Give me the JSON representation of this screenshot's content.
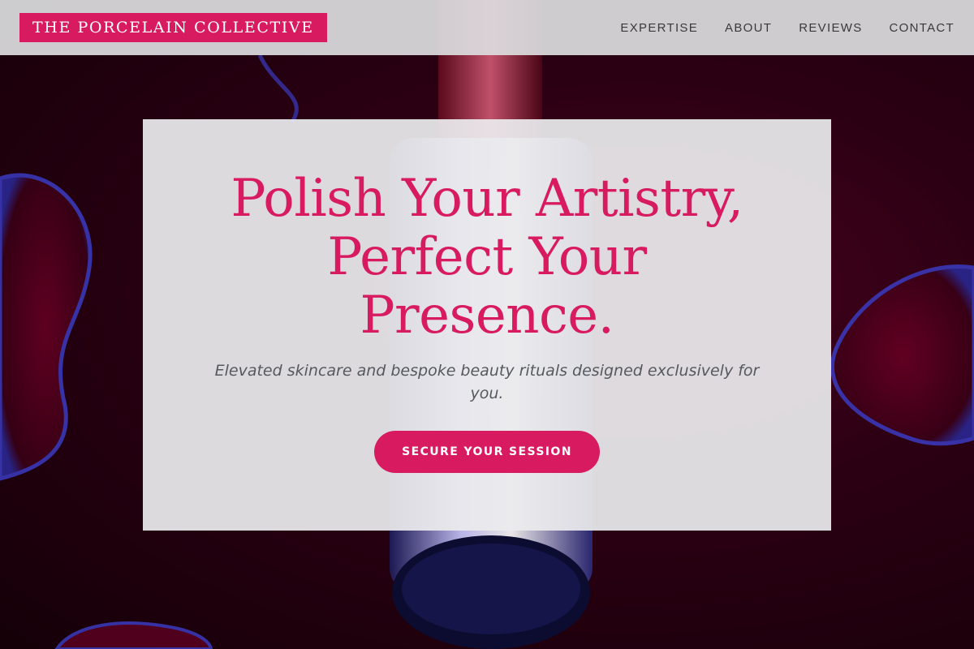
{
  "header": {
    "brand": "THE PORCELAIN COLLECTIVE",
    "nav": [
      "EXPERTISE",
      "ABOUT",
      "REVIEWS",
      "CONTACT"
    ]
  },
  "hero": {
    "title_lines": [
      "Polish Your Artistry,",
      "Perfect Your",
      "Presence."
    ],
    "subtitle": "Elevated skincare and bespoke beauty rituals designed exclusively for you.",
    "cta": "SECURE YOUR SESSION"
  },
  "background": {
    "description_icon": "cosmetic-bottle-image",
    "accent_color": "#d81b60",
    "dark_color": "#2a0012"
  },
  "colors": {
    "brand": "#d81b60",
    "nav_text": "#3a3a3a",
    "subtitle_text": "#55595e"
  }
}
